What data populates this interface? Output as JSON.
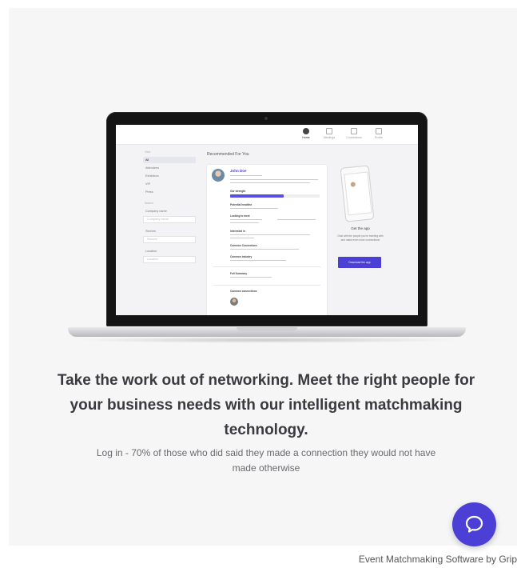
{
  "hero": {
    "headline": "Take the work out of networking. Meet the right people for your business needs with our intelligent matchmaking technology.",
    "subtext": "Log in - 70% of those who did said they made a connection they would not have made otherwise"
  },
  "footer": {
    "link_text": "Event Matchmaking Software by Grip"
  },
  "colors": {
    "accent": "#4b3fd6",
    "panel_background": "#f6f6f7",
    "headline_text": "#3a3a3f"
  },
  "screenshot": {
    "nav": [
      {
        "label": "Home"
      },
      {
        "label": "Meetings"
      },
      {
        "label": "Connections"
      },
      {
        "label": "Profile"
      }
    ],
    "sidebar": {
      "filter_label": "View",
      "items": [
        "All",
        "Attendees",
        "Exhibitors",
        "VIP",
        "Press"
      ],
      "search_label": "Search",
      "company_label": "Company name",
      "company_placeholder": "Company name",
      "sector_label": "Sectors",
      "sector_placeholder": "Sectors",
      "location_label": "Location",
      "location_placeholder": "Location"
    },
    "recommended_title": "Recommended For You",
    "card": {
      "name": "John Doe",
      "match_label": "Our strength",
      "headline_label": "Potential headline",
      "looking_label": "Looking to meet",
      "interested_label": "Interested in",
      "connections_label": "Common Connections",
      "industry_label": "Common industry",
      "full_summary_label": "Full Summary",
      "common_connections_label": "Common connections"
    },
    "get_app": {
      "title": "Get the app",
      "description": "Chat with the people you're meeting with and make even more connections!",
      "button": "Download the app"
    },
    "icons": {
      "chat": "chat-bubble-icon"
    }
  }
}
